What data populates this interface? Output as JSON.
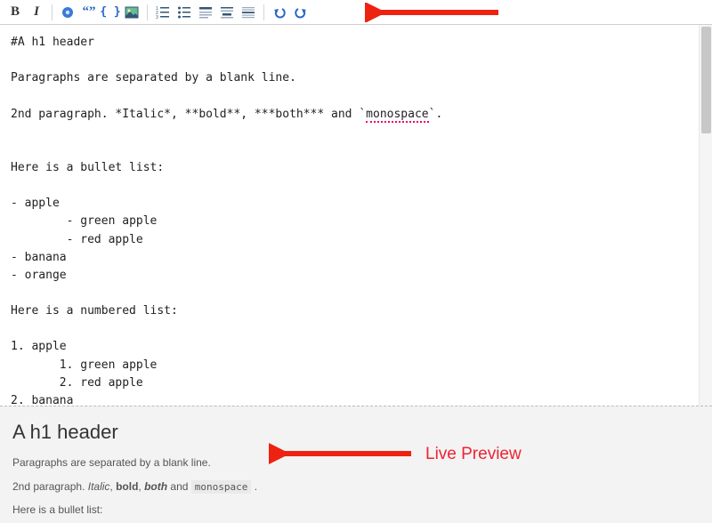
{
  "toolbar": {
    "bold_label": "B",
    "italic_label": "I"
  },
  "editor": {
    "lines": {
      "l1": "#A h1 header",
      "l2": "",
      "l3": "Paragraphs are separated by a blank line.",
      "l4": "",
      "l5_pre": "2nd paragraph. *Italic*, **bold**, ***both*** and `",
      "l5_mono": "monospace",
      "l5_post": "`.",
      "l6": "",
      "l7": "",
      "l8": "Here is a bullet list:",
      "l9": "",
      "l10": "- apple",
      "l11": "        - green apple",
      "l12": "        - red apple",
      "l13": "- banana",
      "l14": "- orange",
      "l15": "",
      "l16": "Here is a numbered list:",
      "l17": "",
      "l18": "1. apple",
      "l19": "       1. green apple",
      "l20": "       2. red apple",
      "l21": "2. banana"
    }
  },
  "preview": {
    "h1": "A h1 header",
    "p1": "Paragraphs are separated by a blank line.",
    "p2_pre": "2nd paragraph. ",
    "p2_italic": "Italic",
    "p2_sep1": ", ",
    "p2_bold": "bold",
    "p2_sep2": ", ",
    "p2_both": "both",
    "p2_sep3": " and ",
    "p2_mono": "monospace",
    "p2_post": " .",
    "p3": "Here is a bullet list:"
  },
  "annotations": {
    "live_preview": "Live Preview"
  }
}
